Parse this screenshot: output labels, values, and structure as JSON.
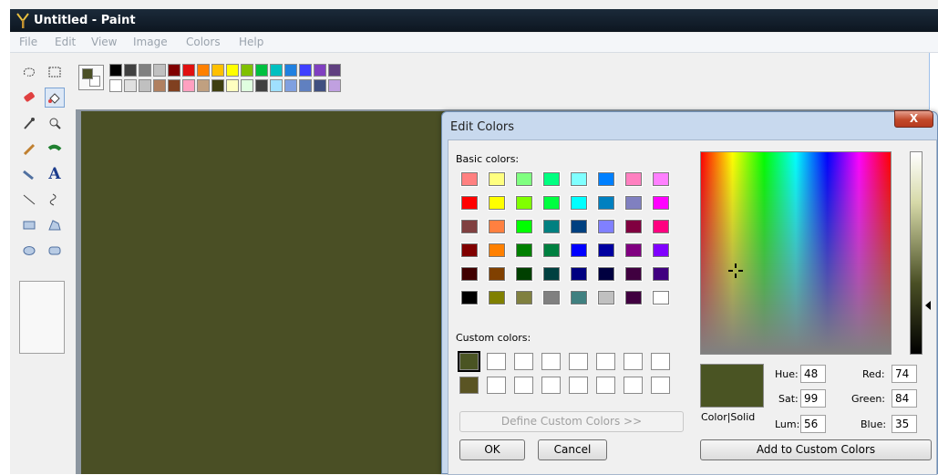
{
  "window": {
    "title": "Untitled - Paint"
  },
  "menu": [
    "File",
    "Edit",
    "View",
    "Image",
    "Colors",
    "Help"
  ],
  "palette": {
    "row1": [
      "#000000",
      "#404040",
      "#808080",
      "#c0c0c0",
      "#800000",
      "#e01010",
      "#ff8000",
      "#ffc000",
      "#ffff00",
      "#80c000",
      "#00c040",
      "#00c0c0",
      "#2080e0",
      "#4040ff",
      "#8040c0",
      "#604080"
    ],
    "row2": [
      "#ffffff",
      "#e0e0e0",
      "#c0c0c0",
      "#b08060",
      "#804020",
      "#ffa0c0",
      "#c0a080",
      "#404010",
      "#ffffc0",
      "#e0ffe0",
      "#404040",
      "#a0e0ff",
      "#80a0e0",
      "#6080c0",
      "#405080",
      "#c0a0e0"
    ]
  },
  "dialog": {
    "title": "Edit Colors",
    "close_label": "X",
    "basic_colors_label": "Basic colors:",
    "basic_colors": [
      [
        "#ff8080",
        "#ffff80",
        "#80ff80",
        "#00ff80",
        "#80ffff",
        "#0080ff",
        "#ff80c0",
        "#ff80ff"
      ],
      [
        "#ff0000",
        "#ffff00",
        "#80ff00",
        "#00ff40",
        "#00ffff",
        "#0080c0",
        "#8080c0",
        "#ff00ff"
      ],
      [
        "#804040",
        "#ff8040",
        "#00ff00",
        "#008080",
        "#004080",
        "#8080ff",
        "#800040",
        "#ff0080"
      ],
      [
        "#800000",
        "#ff8000",
        "#008000",
        "#008040",
        "#0000ff",
        "#0000a0",
        "#800080",
        "#8000ff"
      ],
      [
        "#400000",
        "#804000",
        "#004000",
        "#004040",
        "#000080",
        "#000040",
        "#400040",
        "#400080"
      ],
      [
        "#000000",
        "#808000",
        "#808040",
        "#808080",
        "#408080",
        "#c0c0c0",
        "#400040",
        "#ffffff"
      ]
    ],
    "custom_colors_label": "Custom colors:",
    "custom_colors": [
      [
        "#4a5423",
        "#ffffff",
        "#ffffff",
        "#ffffff",
        "#ffffff",
        "#ffffff",
        "#ffffff",
        "#ffffff"
      ],
      [
        "#5a5423",
        "#ffffff",
        "#ffffff",
        "#ffffff",
        "#ffffff",
        "#ffffff",
        "#ffffff",
        "#ffffff"
      ]
    ],
    "define_custom_label": "Define Custom Colors >>",
    "ok_label": "OK",
    "cancel_label": "Cancel",
    "color_solid_label": "Color|Solid",
    "hue_label": "Hue:",
    "hue_value": "48",
    "sat_label": "Sat:",
    "sat_value": "99",
    "lum_label": "Lum:",
    "lum_value": "56",
    "red_label": "Red:",
    "red_value": "74",
    "green_label": "Green:",
    "green_value": "84",
    "blue_label": "Blue:",
    "blue_value": "35",
    "add_custom_label": "Add to Custom Colors"
  }
}
